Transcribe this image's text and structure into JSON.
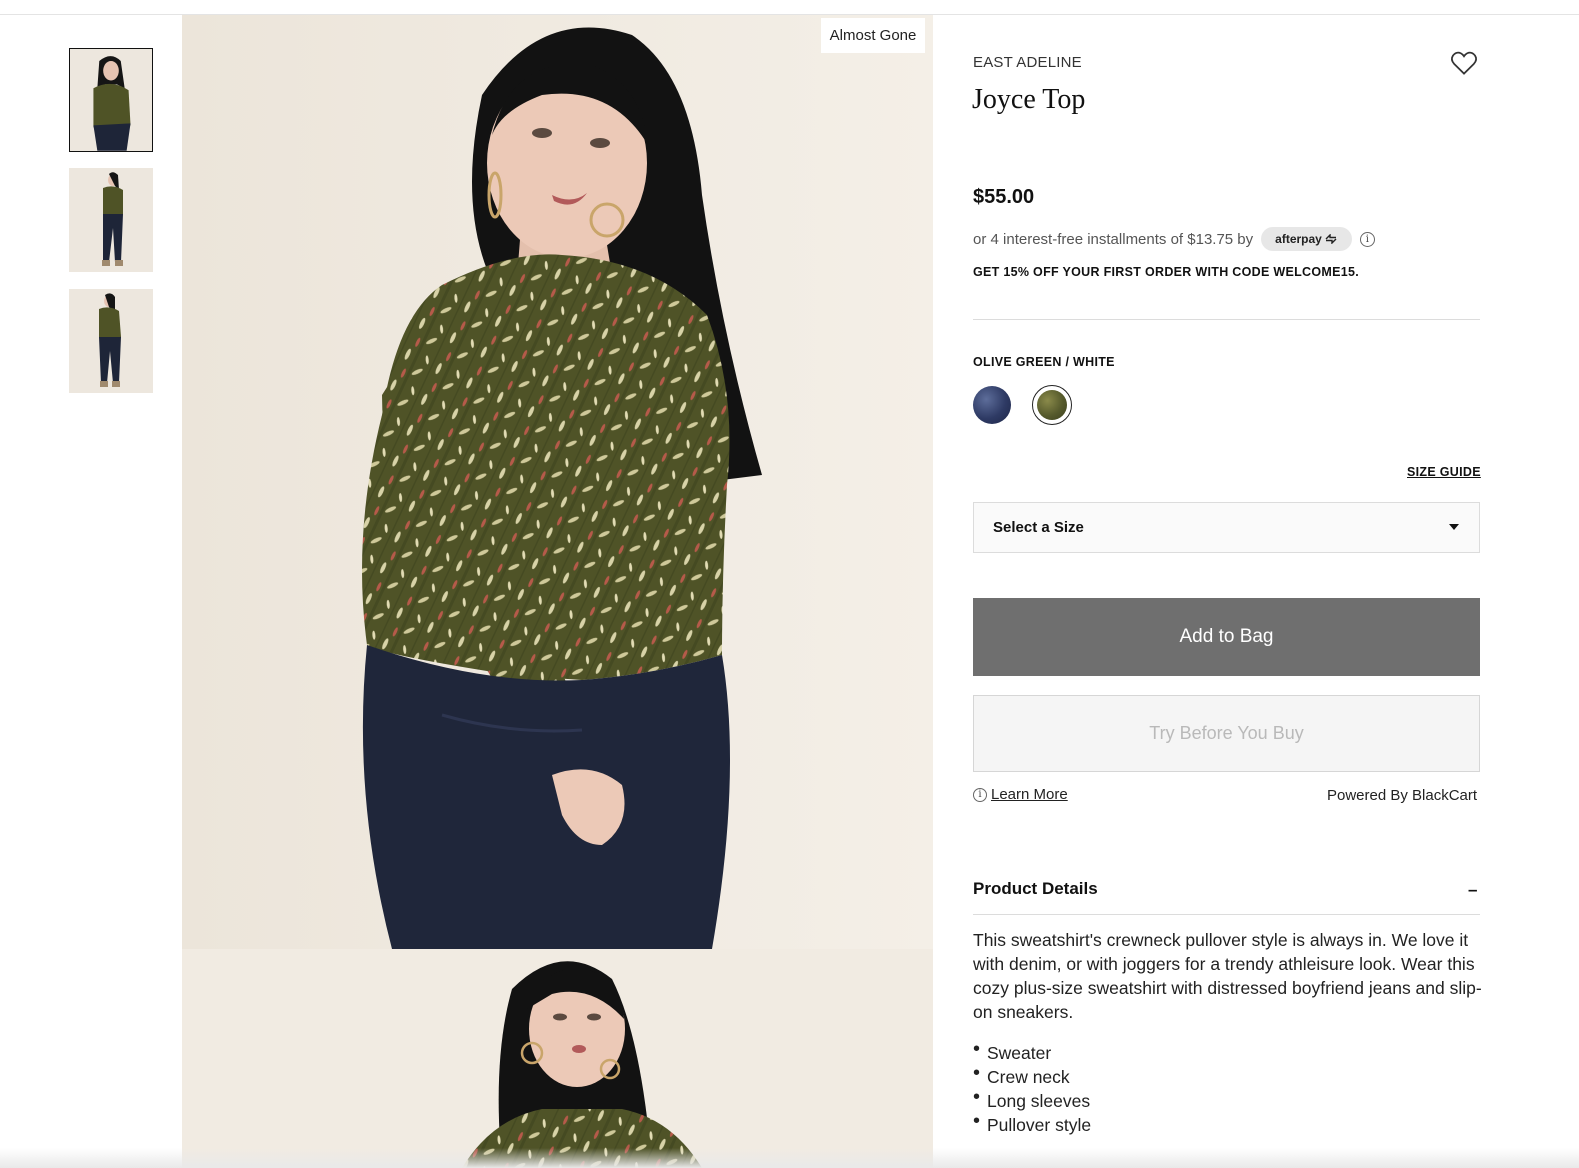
{
  "gallery": {
    "thumbnails": [
      {
        "name": "thumbnail-front",
        "selected": true
      },
      {
        "name": "thumbnail-full",
        "selected": false
      },
      {
        "name": "thumbnail-side",
        "selected": false
      }
    ],
    "badge": "Almost Gone"
  },
  "product": {
    "brand": "EAST ADELINE",
    "title": "Joyce Top",
    "price": "$55.00",
    "installments_text": "or 4 interest-free installments of $13.75 by",
    "afterpay_label": "afterpay",
    "promo": "GET 15% OFF YOUR FIRST ORDER WITH CODE WELCOME15.",
    "color_label": "OLIVE GREEN / WHITE",
    "swatches": [
      {
        "name": "navy",
        "color": "#2e3a64",
        "selected": false
      },
      {
        "name": "olive-green",
        "color": "#565a2c",
        "selected": true
      }
    ],
    "size_guide": "SIZE GUIDE",
    "size_select": "Select a Size",
    "add_to_bag": "Add to Bag",
    "try_before": "Try Before You Buy",
    "learn_more": "Learn More",
    "powered_by": "Powered By BlackCart"
  },
  "details": {
    "heading": "Product Details",
    "toggle": "–",
    "description": "This sweatshirt's crewneck pullover style is always in. We love it with denim, or with joggers for a trendy athleisure look. Wear this cozy plus-size sweatshirt with distressed boyfriend jeans and slip-on sneakers.",
    "bullets": [
      "Sweater",
      "Crew neck",
      "Long sleeves",
      "Pullover style"
    ]
  },
  "icons": {
    "wishlist": "heart-icon",
    "info": "info-icon",
    "dropdown": "caret-down-icon"
  }
}
